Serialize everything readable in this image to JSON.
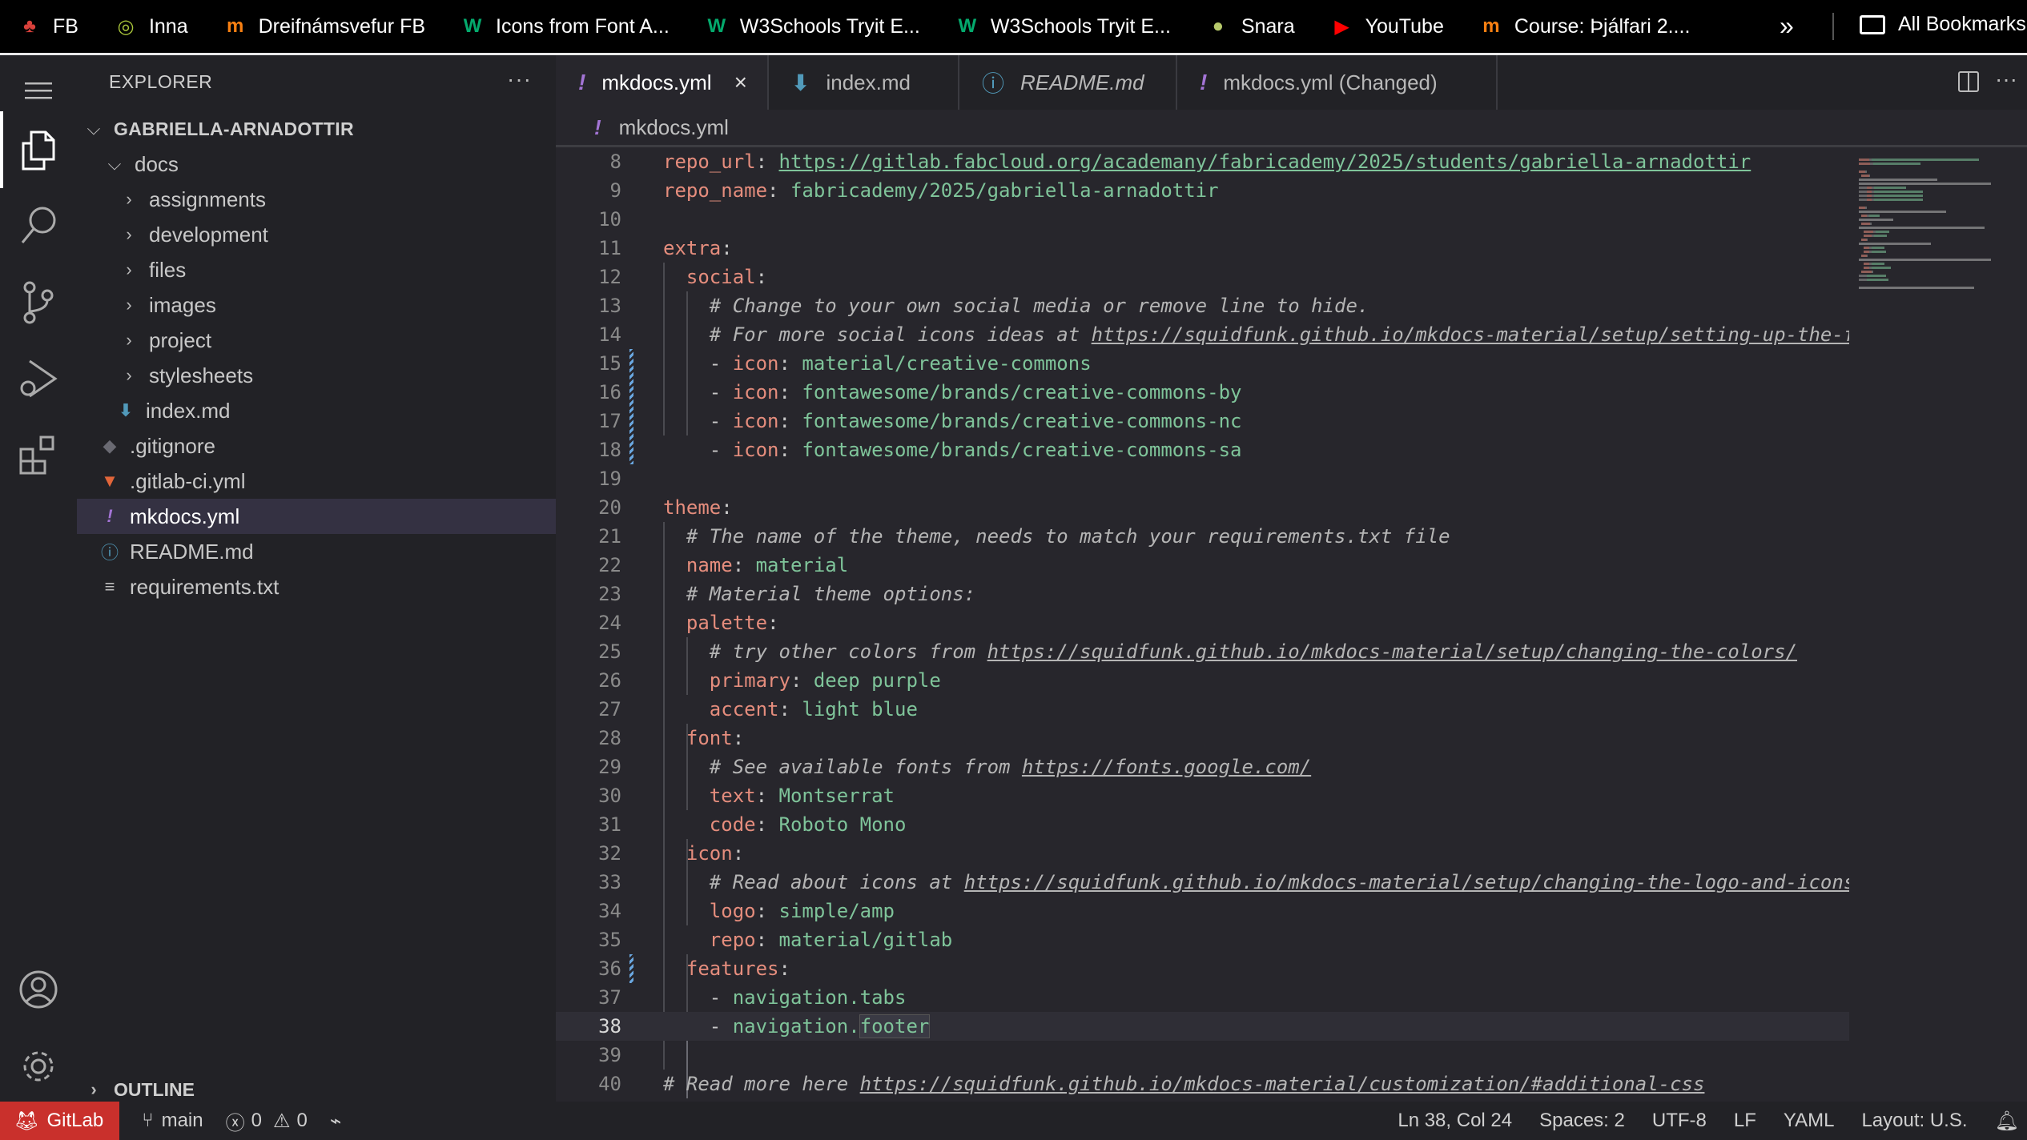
{
  "bookmarks": {
    "items": [
      {
        "label": "FB",
        "icon": "red-tree-icon",
        "color": "#d9413b"
      },
      {
        "label": "Inna",
        "icon": "target-ring-icon",
        "color": "#a8c43a"
      },
      {
        "label": "Dreifnámsvefur FB",
        "icon": "moodle-icon",
        "color": "#f98012"
      },
      {
        "label": "Icons from Font A...",
        "icon": "w3schools-icon",
        "color": "#04aa6d"
      },
      {
        "label": "W3Schools Tryit E...",
        "icon": "w3schools-icon",
        "color": "#04aa6d"
      },
      {
        "label": "W3Schools Tryit E...",
        "icon": "w3schools-icon",
        "color": "#04aa6d"
      },
      {
        "label": "Snara",
        "icon": "snara-icon",
        "color": "#b7c96b"
      },
      {
        "label": "YouTube",
        "icon": "youtube-icon",
        "color": "#ff0000"
      },
      {
        "label": "Course: Þjálfari 2....",
        "icon": "moodle-icon",
        "color": "#f98012"
      }
    ],
    "overflow_glyph": "»",
    "all_bookmarks": "All Bookmarks"
  },
  "explorer": {
    "title": "EXPLORER",
    "more": "···",
    "root": "GABRIELLA-ARNADOTTIR",
    "tree": [
      {
        "label": "docs",
        "type": "folder-open",
        "depth": 1
      },
      {
        "label": "assignments",
        "type": "folder",
        "depth": 2
      },
      {
        "label": "development",
        "type": "folder",
        "depth": 2
      },
      {
        "label": "files",
        "type": "folder",
        "depth": 2
      },
      {
        "label": "images",
        "type": "folder",
        "depth": 2
      },
      {
        "label": "project",
        "type": "folder",
        "depth": 2
      },
      {
        "label": "stylesheets",
        "type": "folder",
        "depth": 2
      },
      {
        "label": "index.md",
        "type": "markdown",
        "depth": 2
      },
      {
        "label": ".gitignore",
        "type": "git",
        "depth": 1
      },
      {
        "label": ".gitlab-ci.yml",
        "type": "gitlab",
        "depth": 1
      },
      {
        "label": "mkdocs.yml",
        "type": "yaml",
        "depth": 1,
        "selected": true
      },
      {
        "label": "README.md",
        "type": "info",
        "depth": 1
      },
      {
        "label": "requirements.txt",
        "type": "text",
        "depth": 1
      }
    ],
    "outline": "OUTLINE"
  },
  "tabs": [
    {
      "label": "mkdocs.yml",
      "icon": "!",
      "active": true,
      "closable": true
    },
    {
      "label": "index.md",
      "icon": "↓",
      "active": false
    },
    {
      "label": "README.md",
      "icon": "ⓘ",
      "active": false,
      "italic": true
    },
    {
      "label": "mkdocs.yml (Changed)",
      "icon": "!",
      "active": false
    }
  ],
  "breadcrumb": {
    "file": "mkdocs.yml",
    "icon": "!"
  },
  "code": {
    "current_line": 38,
    "lines": [
      {
        "n": "8",
        "segs": [
          [
            "k",
            "repo_url"
          ],
          [
            "p",
            ": "
          ],
          [
            "vu",
            "https://gitlab.fabcloud.org/academany/fabricademy/2025/students/gabriella-arnadottir"
          ]
        ]
      },
      {
        "n": "9",
        "segs": [
          [
            "k",
            "repo_name"
          ],
          [
            "p",
            ": "
          ],
          [
            "v",
            "fabricademy/2025/gabriella-arnadottir"
          ]
        ]
      },
      {
        "n": "10",
        "segs": []
      },
      {
        "n": "11",
        "segs": [
          [
            "k",
            "extra"
          ],
          [
            "p",
            ":"
          ]
        ]
      },
      {
        "n": "12",
        "segs": [
          [
            "p",
            "  "
          ],
          [
            "k",
            "social"
          ],
          [
            "p",
            ":"
          ]
        ]
      },
      {
        "n": "13",
        "segs": [
          [
            "c",
            "    # Change to your own social media or remove line to hide."
          ]
        ]
      },
      {
        "n": "14",
        "segs": [
          [
            "c",
            "    # For more social icons ideas at "
          ],
          [
            "cu",
            "https://squidfunk.github.io/mkdocs-material/setup/setting-up-the-f"
          ]
        ]
      },
      {
        "n": "15",
        "segs": [
          [
            "p",
            "    - "
          ],
          [
            "k",
            "icon"
          ],
          [
            "p",
            ": "
          ],
          [
            "v",
            "material/creative-commons"
          ]
        ]
      },
      {
        "n": "16",
        "segs": [
          [
            "p",
            "    - "
          ],
          [
            "k",
            "icon"
          ],
          [
            "p",
            ": "
          ],
          [
            "v",
            "fontawesome/brands/creative-commons-by"
          ]
        ]
      },
      {
        "n": "17",
        "segs": [
          [
            "p",
            "    - "
          ],
          [
            "k",
            "icon"
          ],
          [
            "p",
            ": "
          ],
          [
            "v",
            "fontawesome/brands/creative-commons-nc"
          ]
        ]
      },
      {
        "n": "18",
        "segs": [
          [
            "p",
            "    - "
          ],
          [
            "k",
            "icon"
          ],
          [
            "p",
            ": "
          ],
          [
            "v",
            "fontawesome/brands/creative-commons-sa"
          ]
        ]
      },
      {
        "n": "19",
        "segs": []
      },
      {
        "n": "20",
        "segs": [
          [
            "k",
            "theme"
          ],
          [
            "p",
            ":"
          ]
        ]
      },
      {
        "n": "21",
        "segs": [
          [
            "c",
            "  # The name of the theme, needs to match your requirements.txt file"
          ]
        ]
      },
      {
        "n": "22",
        "segs": [
          [
            "p",
            "  "
          ],
          [
            "k",
            "name"
          ],
          [
            "p",
            ": "
          ],
          [
            "v",
            "material"
          ]
        ]
      },
      {
        "n": "23",
        "segs": [
          [
            "c",
            "  # Material theme options:"
          ]
        ]
      },
      {
        "n": "24",
        "segs": [
          [
            "p",
            "  "
          ],
          [
            "k",
            "palette"
          ],
          [
            "p",
            ":"
          ]
        ]
      },
      {
        "n": "25",
        "segs": [
          [
            "c",
            "    # try other colors from "
          ],
          [
            "cu",
            "https://squidfunk.github.io/mkdocs-material/setup/changing-the-colors/"
          ]
        ]
      },
      {
        "n": "26",
        "segs": [
          [
            "p",
            "    "
          ],
          [
            "k",
            "primary"
          ],
          [
            "p",
            ": "
          ],
          [
            "v",
            "deep purple"
          ]
        ]
      },
      {
        "n": "27",
        "segs": [
          [
            "p",
            "    "
          ],
          [
            "k",
            "accent"
          ],
          [
            "p",
            ": "
          ],
          [
            "v",
            "light blue"
          ]
        ]
      },
      {
        "n": "28",
        "segs": [
          [
            "p",
            "  "
          ],
          [
            "k",
            "font"
          ],
          [
            "p",
            ":"
          ]
        ]
      },
      {
        "n": "29",
        "segs": [
          [
            "c",
            "    # See available fonts from "
          ],
          [
            "cu",
            "https://fonts.google.com/"
          ]
        ]
      },
      {
        "n": "30",
        "segs": [
          [
            "p",
            "    "
          ],
          [
            "k",
            "text"
          ],
          [
            "p",
            ": "
          ],
          [
            "v",
            "Montserrat"
          ]
        ]
      },
      {
        "n": "31",
        "segs": [
          [
            "p",
            "    "
          ],
          [
            "k",
            "code"
          ],
          [
            "p",
            ": "
          ],
          [
            "v",
            "Roboto Mono"
          ]
        ]
      },
      {
        "n": "32",
        "segs": [
          [
            "p",
            "  "
          ],
          [
            "k",
            "icon"
          ],
          [
            "p",
            ":"
          ]
        ]
      },
      {
        "n": "33",
        "segs": [
          [
            "c",
            "    # Read about icons at "
          ],
          [
            "cu",
            "https://squidfunk.github.io/mkdocs-material/setup/changing-the-logo-and-icons"
          ]
        ]
      },
      {
        "n": "34",
        "segs": [
          [
            "p",
            "    "
          ],
          [
            "k",
            "logo"
          ],
          [
            "p",
            ": "
          ],
          [
            "v",
            "simple/amp"
          ]
        ]
      },
      {
        "n": "35",
        "segs": [
          [
            "p",
            "    "
          ],
          [
            "k",
            "repo"
          ],
          [
            "p",
            ": "
          ],
          [
            "v",
            "material/gitlab"
          ]
        ]
      },
      {
        "n": "36",
        "segs": [
          [
            "p",
            "  "
          ],
          [
            "k",
            "features"
          ],
          [
            "p",
            ":"
          ]
        ]
      },
      {
        "n": "37",
        "segs": [
          [
            "p",
            "    - "
          ],
          [
            "v",
            "navigation.tabs"
          ]
        ]
      },
      {
        "n": "38",
        "segs": [
          [
            "p",
            "    - "
          ],
          [
            "v",
            "navigation."
          ],
          [
            "vw",
            "footer"
          ]
        ]
      },
      {
        "n": "39",
        "segs": []
      },
      {
        "n": "40",
        "segs": [
          [
            "c",
            "# Read more here "
          ],
          [
            "cu",
            "https://squidfunk.github.io/mkdocs-material/customization/#additional-css"
          ]
        ]
      }
    ]
  },
  "statusbar": {
    "remote": "GitLab",
    "branch": "main",
    "errors": "0",
    "warnings": "0",
    "position": "Ln 38, Col 24",
    "spaces": "Spaces: 2",
    "encoding": "UTF-8",
    "eol": "LF",
    "language": "YAML",
    "layout": "Layout: U.S."
  },
  "colors": {
    "key": "#e58d7d",
    "value": "#7fc49a",
    "comment": "#b5b5b5",
    "yaml_icon": "#a374d5",
    "markdown_icon": "#519aba",
    "remote_bg": "#c9302c"
  }
}
